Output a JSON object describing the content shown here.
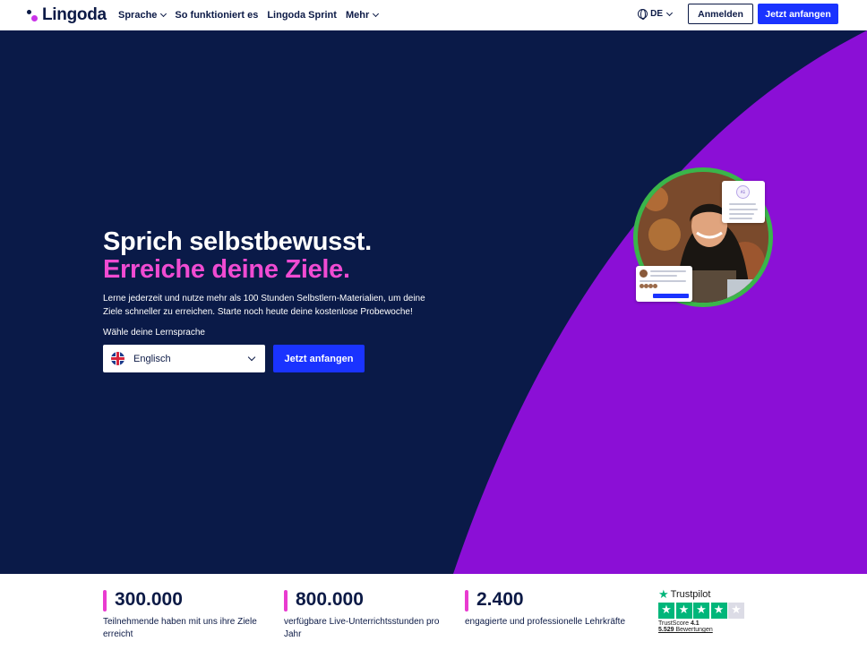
{
  "brand": {
    "name": "Lingoda",
    "navy": "#0a1a48",
    "pink": "#f04bd2",
    "purple": "#8b0fd6",
    "blue": "#1a33ff",
    "green": "#3ab54a"
  },
  "nav": {
    "links": [
      {
        "label": "Sprache",
        "dropdown": true
      },
      {
        "label": "So funktioniert es",
        "dropdown": false
      },
      {
        "label": "Lingoda Sprint",
        "dropdown": false
      },
      {
        "label": "Mehr",
        "dropdown": true
      }
    ],
    "language": "DE",
    "login_label": "Anmelden",
    "cta_label": "Jetzt anfangen"
  },
  "hero": {
    "title_line1": "Sprich selbstbewusst.",
    "title_line2": "Erreiche deine Ziele.",
    "description": "Lerne jederzeit und nutze mehr als 100 Stunden Selbstlern-Materialien, um deine Ziele schneller zu erreichen. Starte noch heute deine kostenlose Probewoche!",
    "choose_label": "Wähle deine Lernsprache",
    "selected_language": "Englisch",
    "cta_label": "Jetzt anfangen"
  },
  "stats": [
    {
      "number": "300.000",
      "description": "Teilnehmende haben mit uns ihre Ziele erreicht"
    },
    {
      "number": "800.000",
      "description": "verfügbare Live-Unterrichtsstunden pro Jahr"
    },
    {
      "number": "2.400",
      "description": "engagierte und professionelle Lehrkräfte"
    }
  ],
  "trustpilot": {
    "brand": "Trustpilot",
    "score_label": "TrustScore",
    "score": "4.1",
    "reviews_count": "5.529",
    "reviews_label": "Bewertungen",
    "stars_filled": 4,
    "stars_total": 5
  }
}
